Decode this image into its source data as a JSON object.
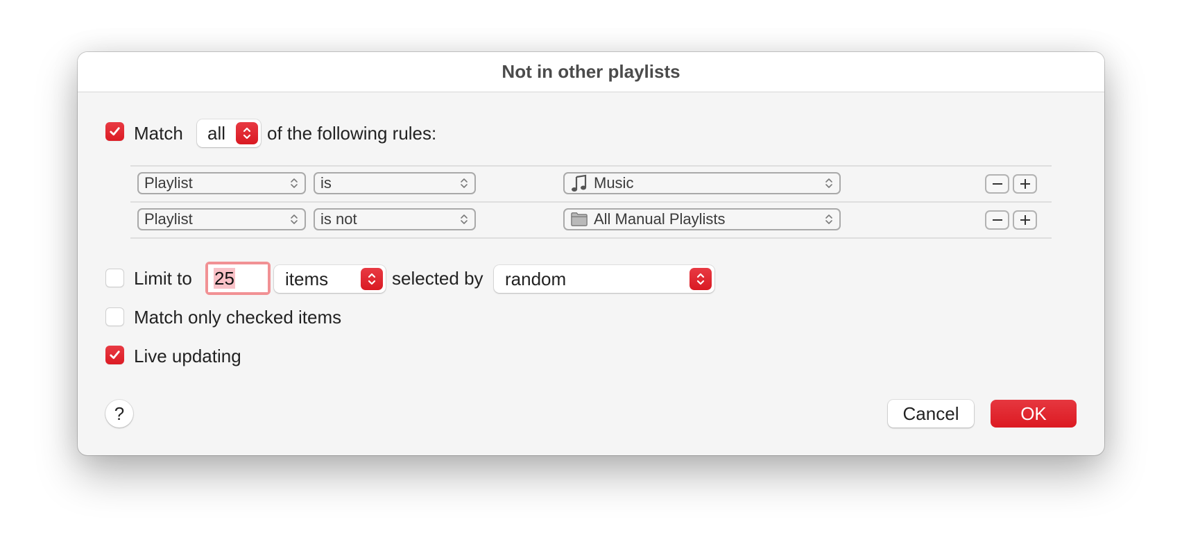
{
  "dialog": {
    "title": "Not in other playlists"
  },
  "match": {
    "checked": true,
    "label": "Match",
    "mode": "all",
    "suffix": "of the following rules:"
  },
  "rules": [
    {
      "field": "Playlist",
      "operator": "is",
      "value": "Music",
      "value_icon": "music-note-icon"
    },
    {
      "field": "Playlist",
      "operator": "is not",
      "value": "All Manual Playlists",
      "value_icon": "folder-icon"
    }
  ],
  "rule_buttons": {
    "remove": "−",
    "add": "+"
  },
  "limit": {
    "checked": false,
    "label": "Limit to",
    "value": "25",
    "unit": "items",
    "selected_by_label": "selected by",
    "selected_by": "random"
  },
  "match_checked_only": {
    "checked": false,
    "label": "Match only checked items"
  },
  "live_updating": {
    "checked": true,
    "label": "Live updating"
  },
  "buttons": {
    "help": "?",
    "cancel": "Cancel",
    "ok": "OK"
  },
  "colors": {
    "accent": "#dc1b24",
    "focus_ring": "#f19194",
    "selection": "#f9c1c7"
  }
}
